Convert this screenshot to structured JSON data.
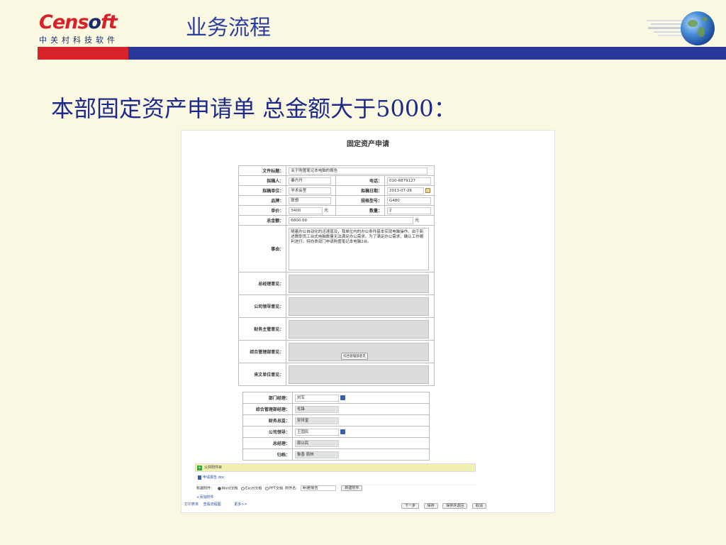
{
  "header": {
    "brand_main": "Cens",
    "brand_o": "o",
    "brand_end": "ft",
    "brand_sub": "中关村科技软件",
    "title": "业务流程"
  },
  "slide": {
    "title": "本部固定资产申请单 总金额大于5000："
  },
  "form": {
    "title": "固定资产申请",
    "fields": {
      "doc_title_label": "文件标题：",
      "doc_title_value": "关于购置笔记本电脑的报告",
      "drafter_label": "拟稿人：",
      "drafter_value": "秦丹丹",
      "phone_label": "电话：",
      "phone_value": "010-6879127",
      "dept_label": "拟稿单位：",
      "dept_value": "学术会室",
      "date_label": "拟稿日期：",
      "date_value": "2013-07-26",
      "brand_label": "品牌：",
      "brand_value": "联想",
      "model_label": "规格型号：",
      "model_value": "G480",
      "price_label": "单价：",
      "price_value": "3400",
      "price_unit": "元",
      "qty_label": "数量：",
      "qty_value": "2",
      "total_label": "总金额：",
      "total_value": "6800.00",
      "total_unit": "元",
      "reason_label": "事由：",
      "reason_value": "随着办公自动化的迅速普及，我单位内的办公条件基本实现电脑操作。由于新进教职员工台式电脑数量无法满足办公需求。为了满足办公需求，确认工作顺利进行，特向贵部门申请购置笔记本电脑2台。",
      "gm_opinion_label": "总经理意见：",
      "leader_opinion_label": "公司领导意见：",
      "finance_opinion_label": "财务主管意见：",
      "admin_opinion_label": "综合管理部意见：",
      "sender_opinion_label": "来文单位意见："
    },
    "tooltip": "综合管理部意见",
    "approvals": [
      {
        "label": "部门经理：",
        "value": "刘军",
        "gray": false,
        "pick": true
      },
      {
        "label": "综合管理部经理：",
        "value": "毛锋",
        "gray": true,
        "pick": false
      },
      {
        "label": "财务总监：",
        "value": "宋世奎",
        "gray": true,
        "pick": false
      },
      {
        "label": "公司领导：",
        "value": "王国民",
        "gray": false,
        "pick": true
      },
      {
        "label": "总经理：",
        "value": "周以民",
        "gray": true,
        "pick": false
      },
      {
        "label": "归档：",
        "value": "鲁香 周林",
        "gray": true,
        "pick": false
      }
    ],
    "attachments": {
      "header": "公共附件目",
      "file": "申请报告.doc",
      "new_label": "新建附件：",
      "opt_word": "Word文档",
      "opt_excel": "Excel文档",
      "opt_ppt": "PPT文档",
      "name_label": "附件名：",
      "name_value": "新建报告",
      "create_btn": "新建附件",
      "add_link": "添加附件"
    },
    "bottom": {
      "link1": "打印表单",
      "link2": "查看流程图",
      "link3": "更多>>",
      "btn_next": "下一步",
      "btn_save": "保存",
      "btn_save_back": "保存并返回",
      "btn_cancel": "取消"
    }
  }
}
